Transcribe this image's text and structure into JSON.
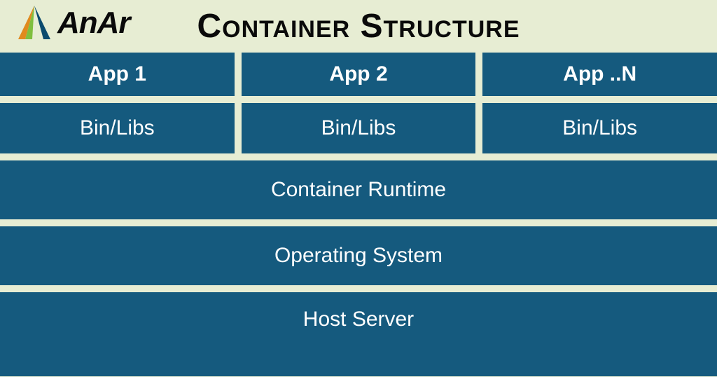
{
  "brand": {
    "name": "AnAr"
  },
  "title": "Container Structure",
  "apps": [
    "App 1",
    "App 2",
    "App ..N"
  ],
  "bins": [
    "Bin/Libs",
    "Bin/Libs",
    "Bin/Libs"
  ],
  "layers": {
    "runtime": "Container Runtime",
    "os": "Operating System",
    "host": "Host Server"
  },
  "colors": {
    "background": "#e7edd3",
    "block": "#155a7e",
    "text": "#ffffff"
  }
}
